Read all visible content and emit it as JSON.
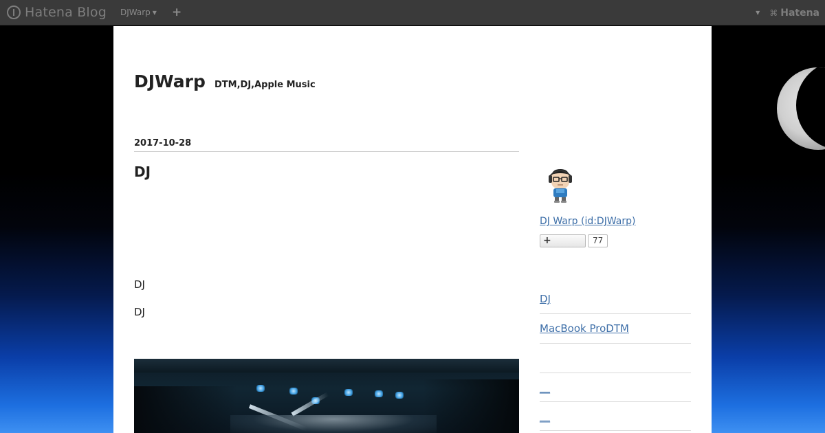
{
  "topbar": {
    "logo_text": "Hatena Blog",
    "blog_dropdown_label": "DJWarp",
    "add_label": "+",
    "right_logo_text": "Hatena"
  },
  "blog": {
    "title": "DJWarp",
    "description": "DTM,DJ,Apple Music"
  },
  "entry": {
    "date": "2017-10-28",
    "title": "DJ",
    "paragraphs": [
      "DJ",
      "DJ"
    ]
  },
  "sidebar": {
    "profile_name": "DJ Warp (id:DJWarp)",
    "subscribe_label": "+",
    "subscriber_count": "77",
    "items": [
      {
        "label": "DJ"
      },
      {
        "label": "MacBook ProDTM"
      },
      {
        "label": ""
      },
      {
        "label": "__"
      },
      {
        "label": "__"
      }
    ]
  },
  "colors": {
    "link": "#3e6fa8",
    "topbar": "#3a3a3a",
    "page_bg": "#ffffff"
  }
}
